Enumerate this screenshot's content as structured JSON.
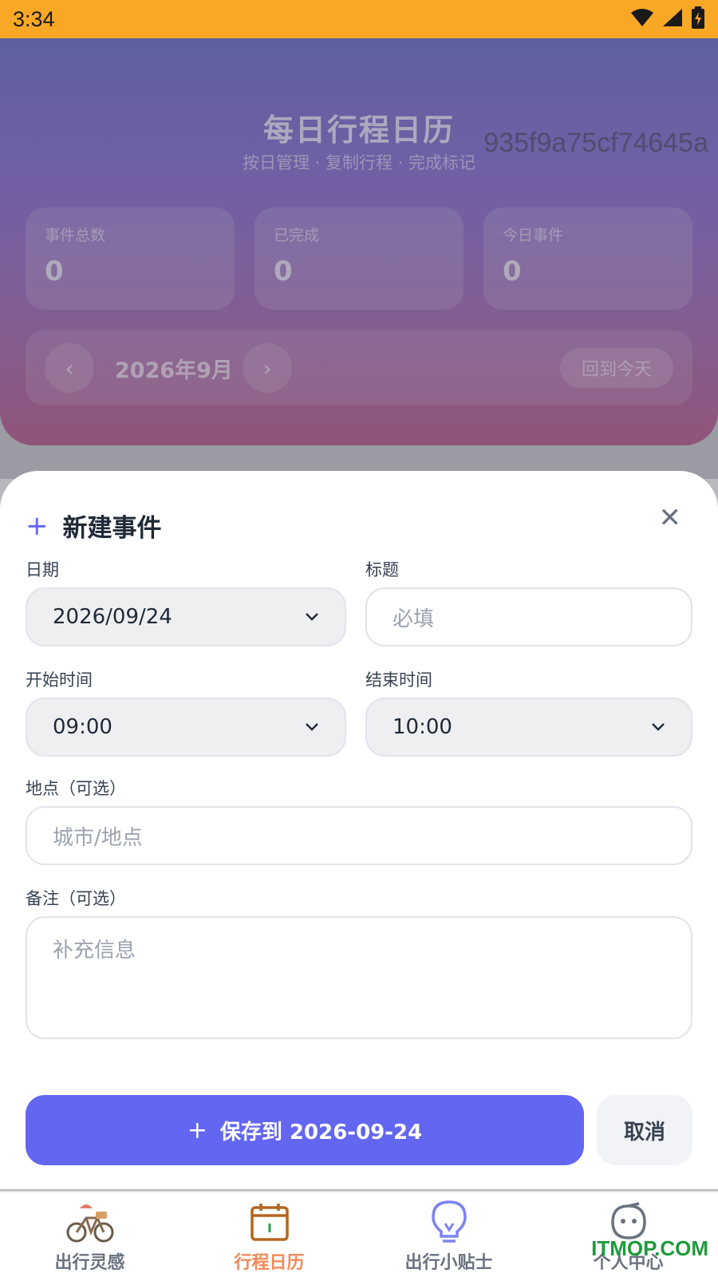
{
  "status_bar": {
    "time": "3:34"
  },
  "hero": {
    "title": "每日行程日历",
    "subtitle": "按日管理 · 复制行程 · 完成标记",
    "stats": [
      {
        "label": "事件总数",
        "value": "0"
      },
      {
        "label": "已完成",
        "value": "0"
      },
      {
        "label": "今日事件",
        "value": "0"
      }
    ],
    "month": "2026年9月",
    "today_button": "回到今天",
    "hash": "935f9a75cf74645a"
  },
  "sheet": {
    "title": "新建事件",
    "date": {
      "label": "日期",
      "value": "2026/09/24"
    },
    "event_title": {
      "label": "标题",
      "placeholder": "必填"
    },
    "start_time": {
      "label": "开始时间",
      "value": "09:00"
    },
    "end_time": {
      "label": "结束时间",
      "value": "10:00"
    },
    "location": {
      "label": "地点（可选）",
      "placeholder": "城市/地点"
    },
    "notes": {
      "label": "备注（可选）",
      "placeholder": "补充信息"
    },
    "save_button": "保存到 2026-09-24",
    "cancel_button": "取消"
  },
  "tabbar": {
    "items": [
      {
        "label": "出行灵感",
        "icon": "bicycle-icon"
      },
      {
        "label": "行程日历",
        "icon": "calendar-icon"
      },
      {
        "label": "出行小贴士",
        "icon": "lightbulb-icon"
      },
      {
        "label": "个人中心",
        "icon": "smile-icon"
      }
    ],
    "active_index": 1,
    "watermark": "ITMOP.COM"
  },
  "colors": {
    "accent": "#6366f1",
    "active_tab": "#f28a5a",
    "status_bar": "#f9a826"
  }
}
